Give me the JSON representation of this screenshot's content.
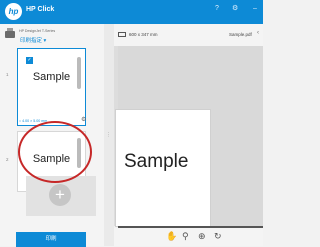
{
  "app": {
    "title": "HP Click",
    "logo": "hp"
  },
  "titlebar": {
    "help_icon": "question-icon",
    "settings_icon": "gear-icon",
    "minimize_icon": "minimize-icon"
  },
  "printer": {
    "name": "HP DesignJet T-Series",
    "preset": "印刷指定 ▾",
    "icon": "printer-icon"
  },
  "pages": [
    {
      "label": "Sample",
      "number": "1",
      "selected": true,
      "checked": "✓",
      "actions": "○ 4.00 × 5.00 mm"
    },
    {
      "label": "Sample",
      "number": "2",
      "selected": false
    }
  ],
  "add_page": {
    "symbol": "+"
  },
  "print_button": {
    "label": "印刷"
  },
  "canvas": {
    "paper_size": "600 x 347 mm",
    "filename": "Sample.pdf",
    "page_label": "Sample"
  },
  "tools": [
    {
      "name": "hand-icon",
      "glyph": "✋"
    },
    {
      "name": "zoom-out-icon",
      "glyph": "⚲"
    },
    {
      "name": "zoom-in-icon",
      "glyph": "⊕"
    },
    {
      "name": "rotate-icon",
      "glyph": "↻"
    }
  ],
  "colors": {
    "accent": "#0d8ad6",
    "highlight": "#c62828"
  }
}
